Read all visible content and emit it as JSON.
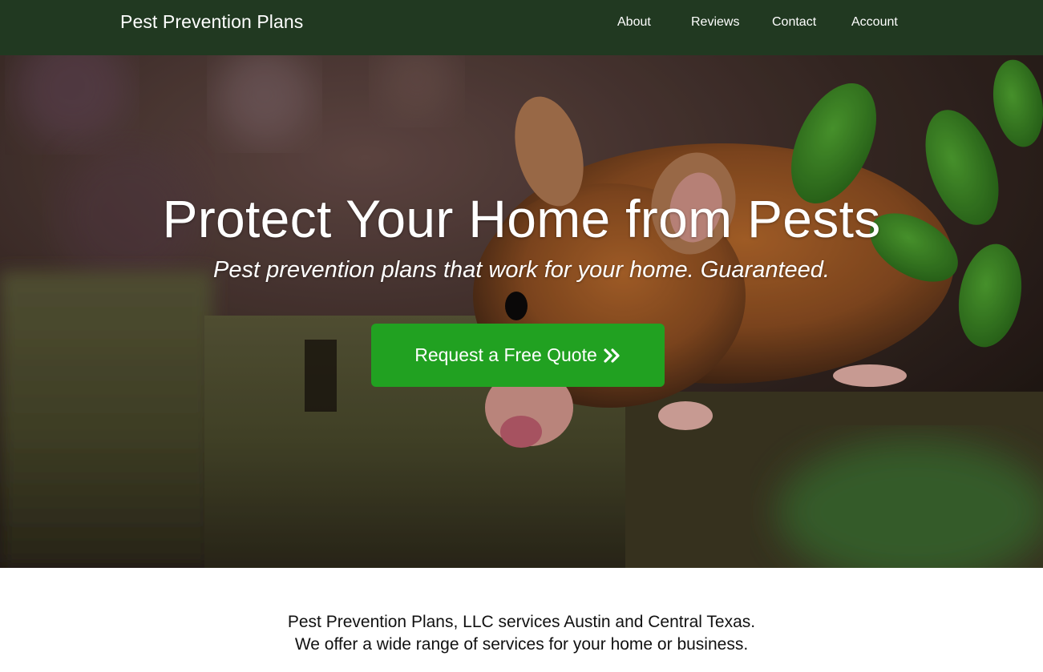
{
  "navbar": {
    "brand": "Pest Prevention Plans",
    "links": [
      {
        "label": "About"
      },
      {
        "label": "Reviews"
      },
      {
        "label": "Contact"
      },
      {
        "label": "Account"
      }
    ],
    "background_color": "#213921"
  },
  "hero": {
    "title": "Protect Your Home from Pests",
    "subtitle": "Pest prevention plans that work for your home. Guaranteed.",
    "cta_label": "Request a Free Quote",
    "cta_icon": "double-chevron-right-icon",
    "cta_color": "#21a121",
    "image_subject": "mouse-on-wooden-fence-photo"
  },
  "intro": {
    "line1": "Pest Prevention Plans, LLC services Austin and Central Texas.",
    "line2": "We offer a wide range of services for your home or business."
  }
}
